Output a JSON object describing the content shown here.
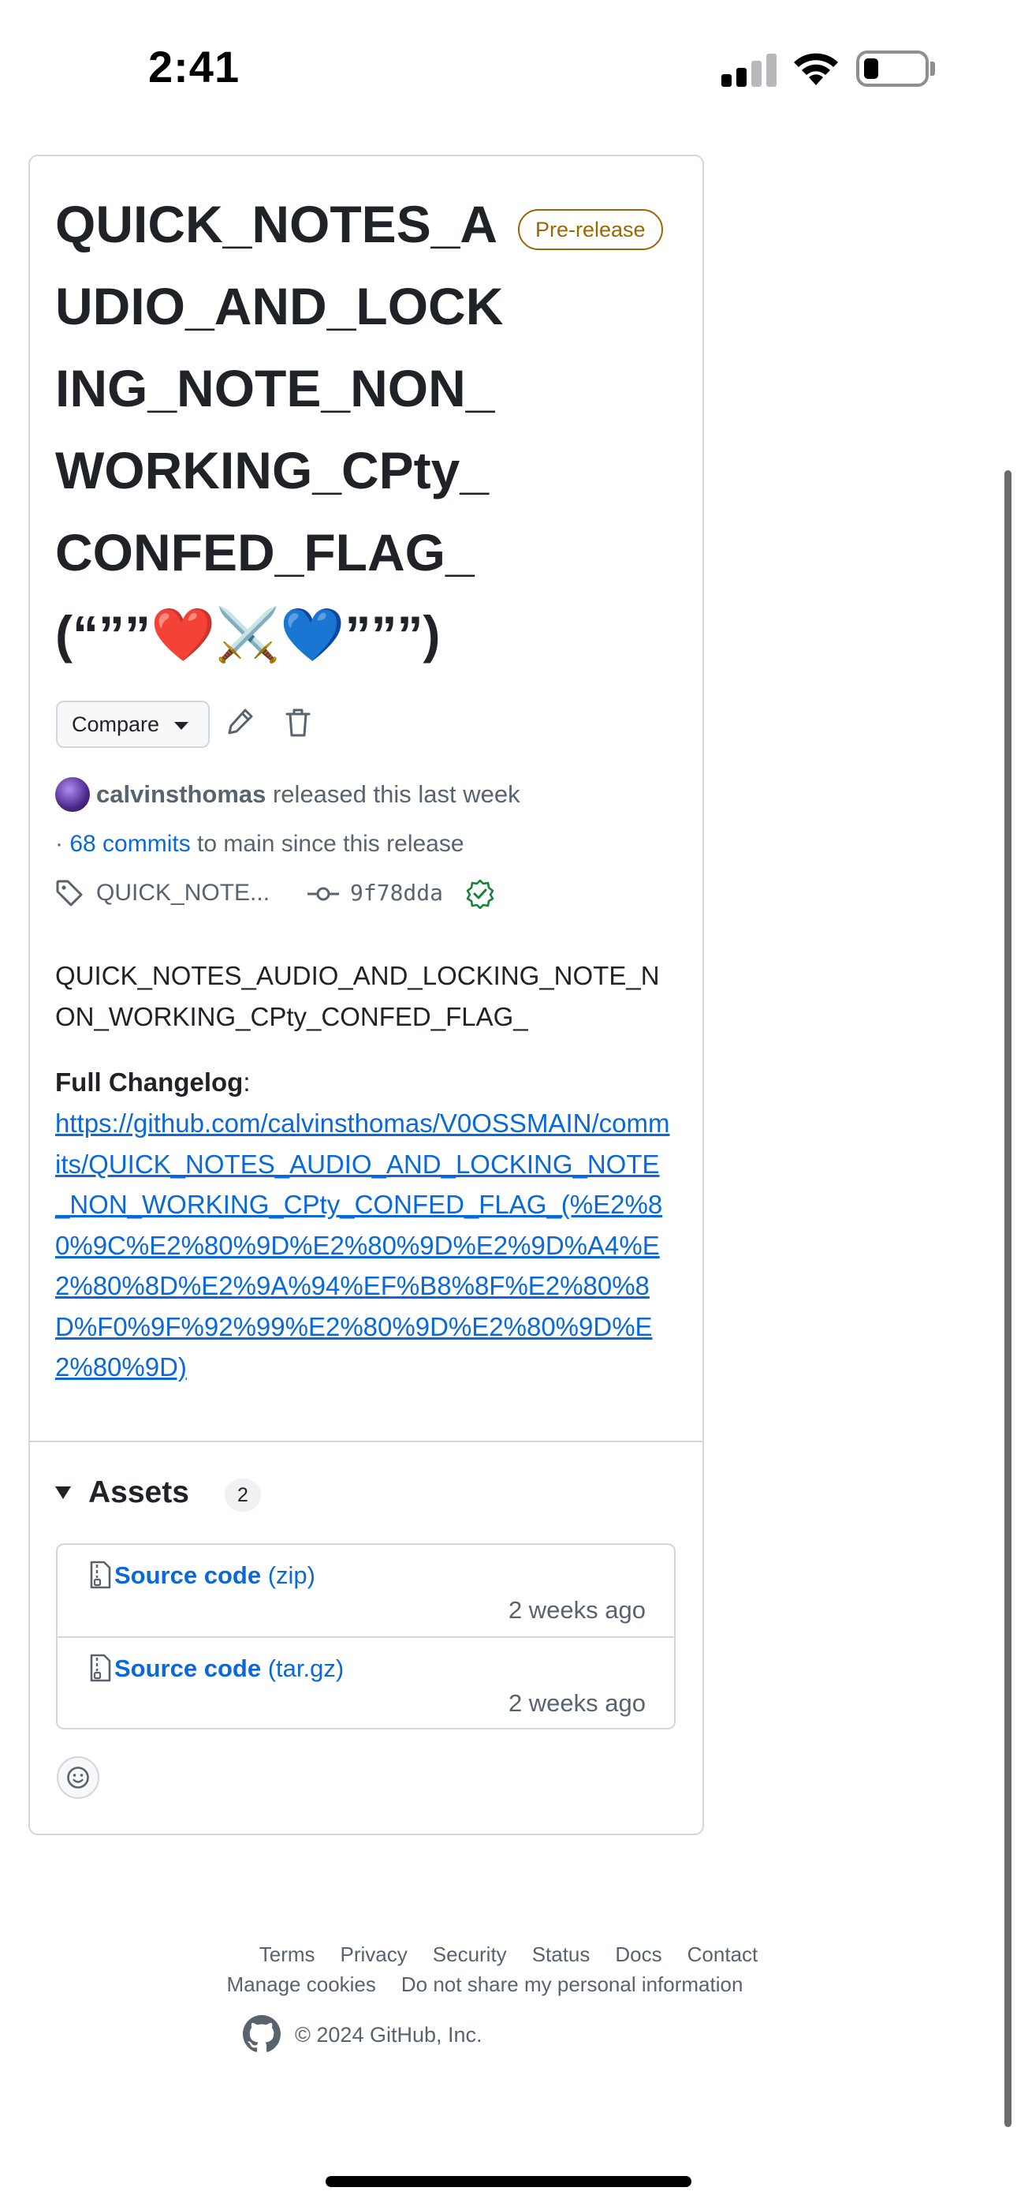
{
  "status_bar": {
    "time": "2:41"
  },
  "release": {
    "title": "QUICK_NOTES_AUDIO_AND_LOCKING_NOTE_NON_WORKING_CPty_CONFED_FLAG_(“””❤️⚔️💙”””)",
    "badge": "Pre-release",
    "compare_label": "Compare",
    "author": "calvinsthomas",
    "released_text": " released this last week",
    "commits_prefix": "· ",
    "commits_link": "68 commits",
    "commits_suffix": " to main since this release",
    "tag": "QUICK_NOTE...",
    "commit_sha": "9f78dda",
    "body": "QUICK_NOTES_AUDIO_AND_LOCKING_NOTE_NON_WORKING_CPty_CONFED_FLAG_",
    "changelog_label": "Full Changelog",
    "changelog_colon": ":",
    "changelog_url": "https://github.com/calvinsthomas/V0OSSMAIN/commits/QUICK_NOTES_AUDIO_AND_LOCKING_NOTE_NON_WORKING_CPty_CONFED_FLAG_(%E2%80%9C%E2%80%9D%E2%80%9D%E2%9D%A4%E2%80%8D%E2%9A%94%EF%B8%8F%E2%80%8D%F0%9F%92%99%E2%80%9D%E2%80%9D%E2%80%9D)"
  },
  "assets": {
    "title": "Assets",
    "count": "2",
    "items": [
      {
        "name": "Source code",
        "ext": "(zip)",
        "date": "2 weeks ago",
        "icon": "file-zip-icon"
      },
      {
        "name": "Source code",
        "ext": "(tar.gz)",
        "date": "2 weeks ago",
        "icon": "file-zip-icon"
      }
    ]
  },
  "footer": {
    "links_row1": [
      "Terms",
      "Privacy",
      "Security",
      "Status",
      "Docs",
      "Contact"
    ],
    "links_row2": [
      "Manage cookies",
      "Do not share my personal information"
    ],
    "copyright": "© 2024 GitHub, Inc."
  },
  "colors": {
    "link": "#0969da",
    "prerelease": "#9a6700",
    "verified": "#1a7f37",
    "border": "#d0d7de",
    "muted": "#59636e"
  }
}
